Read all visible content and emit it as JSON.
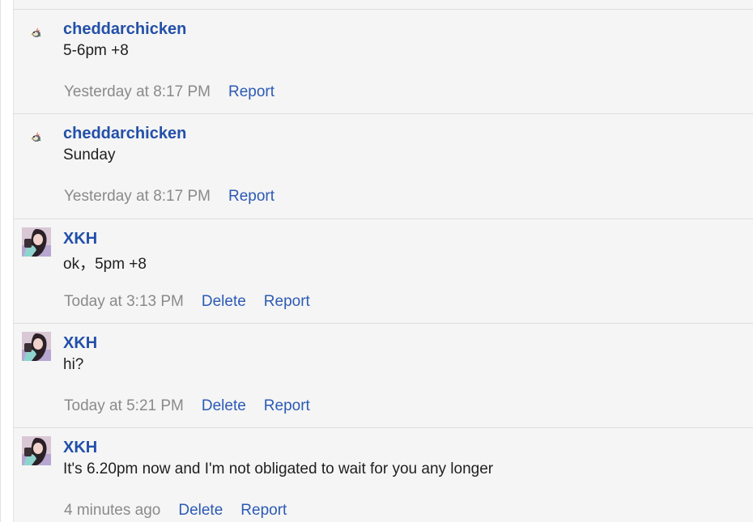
{
  "colors": {
    "author": "#2350a8",
    "link": "#2c5ab5",
    "timestamp": "#8a8a8a",
    "message_text": "#1f1f1f",
    "panel_background": "#f5f5f5",
    "separator": "#dedede"
  },
  "messages": [
    {
      "avatar": "chicken-avatar-icon",
      "author": "cheddarchicken",
      "text": "5-6pm +8",
      "time": "Yesterday at 8:17 PM",
      "actions": [
        "Report"
      ]
    },
    {
      "avatar": "chicken-avatar-icon",
      "author": "cheddarchicken",
      "text": "Sunday",
      "time": "Yesterday at 8:17 PM",
      "actions": [
        "Report"
      ]
    },
    {
      "avatar": "user-photo-avatar",
      "author": "XKH",
      "text": "ok，5pm +8",
      "time": "Today at 3:13 PM",
      "actions": [
        "Delete",
        "Report"
      ]
    },
    {
      "avatar": "user-photo-avatar",
      "author": "XKH",
      "text": "hi?",
      "time": "Today at 5:21 PM",
      "actions": [
        "Delete",
        "Report"
      ]
    },
    {
      "avatar": "user-photo-avatar",
      "author": "XKH",
      "text": "It's 6.20pm now and I'm not obligated to wait for you any longer",
      "time": "4 minutes ago",
      "actions": [
        "Delete",
        "Report"
      ]
    }
  ]
}
